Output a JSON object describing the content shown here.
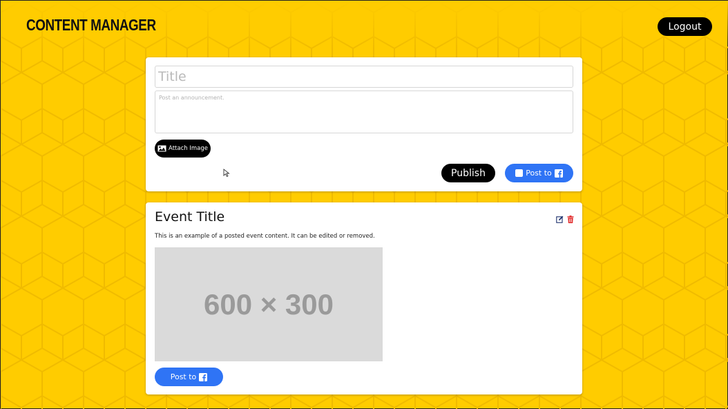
{
  "header": {
    "brand": "CONTENT MANAGER",
    "logout_label": "Logout"
  },
  "composer": {
    "title_placeholder": "Title",
    "body_placeholder": "Post an announcement.",
    "attach_label": "Attach Image",
    "publish_label": "Publish",
    "post_to_label": "Post to",
    "post_to_checked": false
  },
  "posts": [
    {
      "title": "Event Title",
      "body": "This is an example of a posted event content. It can be edited or removed.",
      "image_text": "600 × 300",
      "post_to_label": "Post to"
    }
  ],
  "icons": {
    "attach": "image-icon",
    "facebook": "facebook-icon",
    "edit": "edit-icon",
    "delete": "trash-icon",
    "cursor": "mouse-cursor-icon"
  },
  "colors": {
    "background": "#ffcc00",
    "honeycomb_line": "#f2bd00",
    "primary_button": "#000000",
    "facebook_button": "#2f74f5",
    "edit_icon": "#1b2f6b",
    "delete_icon": "#e02424",
    "image_placeholder": "#dadada"
  }
}
